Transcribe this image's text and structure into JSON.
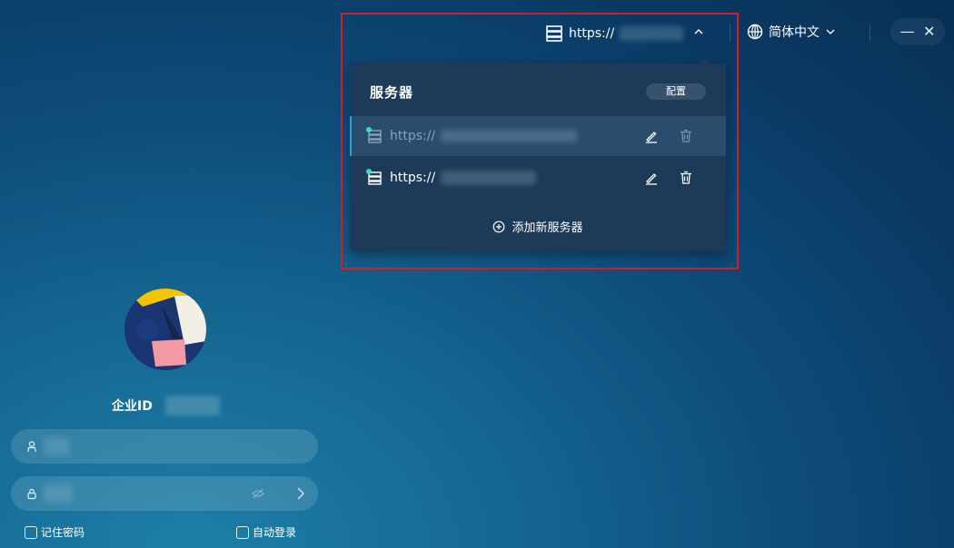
{
  "topbar": {
    "server_url": "https://",
    "language": "简体中文"
  },
  "server_dropdown": {
    "title": "服务器",
    "config_label": "配置",
    "servers": [
      {
        "url": "https://",
        "active": true
      },
      {
        "url": "https://",
        "active": false
      }
    ],
    "add_label": "添加新服务器"
  },
  "login": {
    "enterprise_label": "企业ID",
    "remember_password": "记住密码",
    "auto_login": "自动登录"
  },
  "colors": {
    "accent": "#2a9fd8",
    "status_dot": "#2ee0c8",
    "highlight_box": "#d21f26",
    "dropdown_bg": "#1d3a58"
  }
}
